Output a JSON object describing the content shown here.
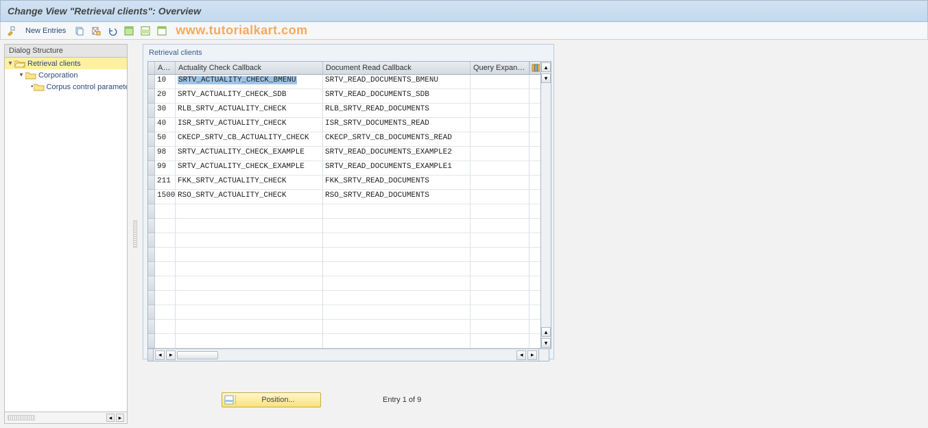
{
  "colors": {
    "accent": "#c3d9ee",
    "highlight": "#fef09e"
  },
  "title": "Change View \"Retrieval clients\": Overview",
  "toolbar": {
    "new_entries": "New Entries",
    "watermark": "www.tutorialkart.com",
    "icons": [
      "toggle",
      "copy",
      "save",
      "undo",
      "select-all",
      "select-block",
      "deselect"
    ]
  },
  "dialog_structure": {
    "header": "Dialog Structure",
    "nodes": [
      {
        "label": "Retrieval clients",
        "level": 1,
        "expanded": true,
        "open": true,
        "selected": true
      },
      {
        "label": "Corporation",
        "level": 2,
        "expanded": true,
        "open": false,
        "selected": false
      },
      {
        "label": "Corpus control parameters",
        "level": 3,
        "expanded": false,
        "open": false,
        "selected": false
      }
    ]
  },
  "grid": {
    "title": "Retrieval clients",
    "columns": {
      "ap": "Ap...",
      "acc": "Actuality Check Callback",
      "drc": "Document Read Callback",
      "qe": "Query Expansio"
    },
    "rows": [
      {
        "ap": "10",
        "acc": "SRTV_ACTUALITY_CHECK_BMENU",
        "drc": "SRTV_READ_DOCUMENTS_BMENU",
        "qe": "",
        "selectedCell": true
      },
      {
        "ap": "20",
        "acc": "SRTV_ACTUALITY_CHECK_SDB",
        "drc": "SRTV_READ_DOCUMENTS_SDB",
        "qe": ""
      },
      {
        "ap": "30",
        "acc": "RLB_SRTV_ACTUALITY_CHECK",
        "drc": "RLB_SRTV_READ_DOCUMENTS",
        "qe": ""
      },
      {
        "ap": "40",
        "acc": "ISR_SRTV_ACTUALITY_CHECK",
        "drc": "ISR_SRTV_DOCUMENTS_READ",
        "qe": ""
      },
      {
        "ap": "50",
        "acc": "CKECP_SRTV_CB_ACTUALITY_CHECK",
        "drc": "CKECP_SRTV_CB_DOCUMENTS_READ",
        "qe": ""
      },
      {
        "ap": "98",
        "acc": "SRTV_ACTUALITY_CHECK_EXAMPLE",
        "drc": "SRTV_READ_DOCUMENTS_EXAMPLE2",
        "qe": ""
      },
      {
        "ap": "99",
        "acc": "SRTV_ACTUALITY_CHECK_EXAMPLE",
        "drc": "SRTV_READ_DOCUMENTS_EXAMPLE1",
        "qe": ""
      },
      {
        "ap": "211",
        "acc": "FKK_SRTV_ACTUALITY_CHECK",
        "drc": "FKK_SRTV_READ_DOCUMENTS",
        "qe": ""
      },
      {
        "ap": "1500",
        "acc": "RSO_SRTV_ACTUALITY_CHECK",
        "drc": "RSO_SRTV_READ_DOCUMENTS",
        "qe": ""
      }
    ],
    "empty_rows": 10
  },
  "footer": {
    "position_label": "Position...",
    "entry_text": "Entry 1 of 9"
  }
}
